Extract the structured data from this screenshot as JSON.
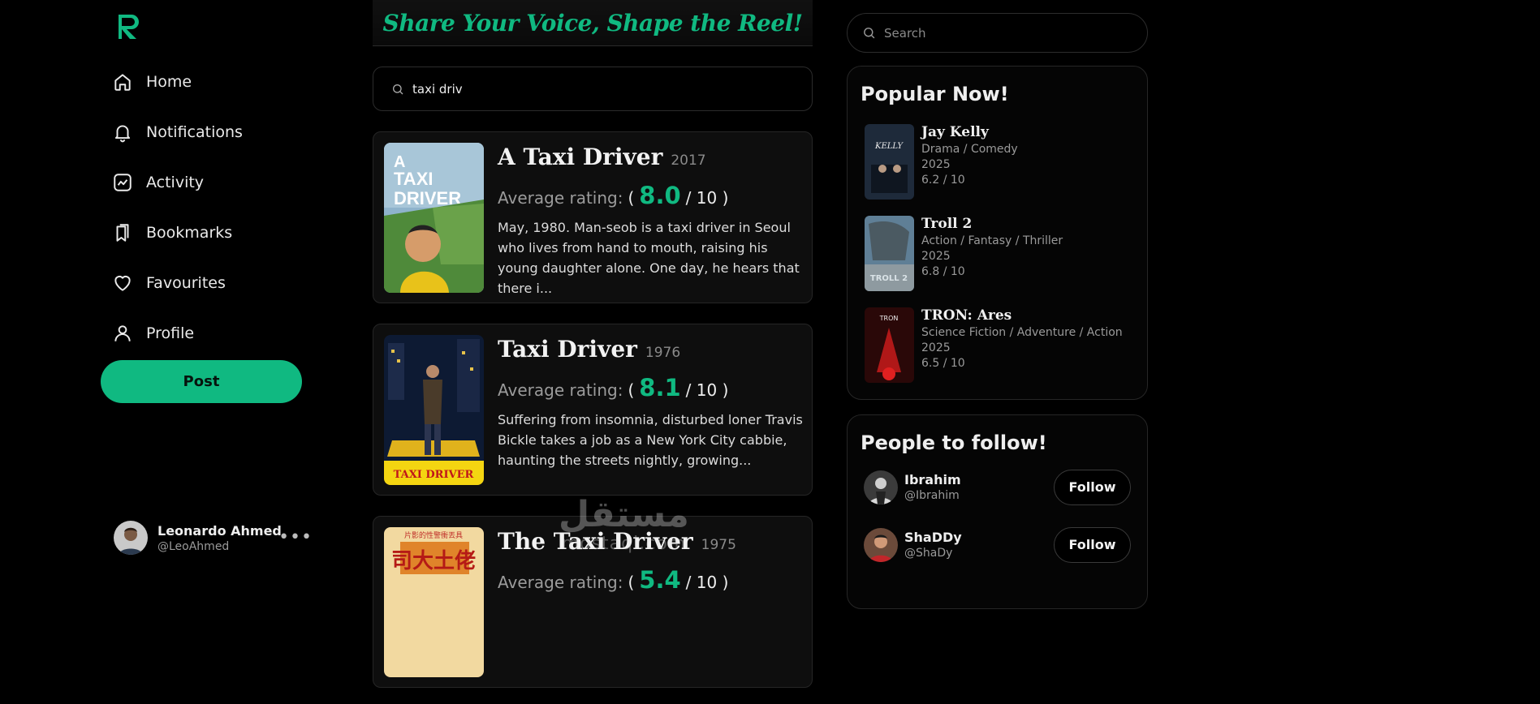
{
  "nav": {
    "items": [
      {
        "label": "Home",
        "icon": "home-icon"
      },
      {
        "label": "Notifications",
        "icon": "bell-icon"
      },
      {
        "label": "Activity",
        "icon": "activity-icon"
      },
      {
        "label": "Bookmarks",
        "icon": "bookmarks-icon"
      },
      {
        "label": "Favourites",
        "icon": "heart-icon"
      },
      {
        "label": "Profile",
        "icon": "user-icon"
      }
    ],
    "post_label": "Post"
  },
  "user": {
    "name": "Leonardo Ahmed",
    "handle": "@LeoAhmed",
    "more": "•••"
  },
  "banner": {
    "text": "Share Your Voice, Shape the Reel!"
  },
  "center_search": {
    "value": "taxi driv"
  },
  "results": [
    {
      "title": "A Taxi Driver",
      "year": "2017",
      "rating_label": "Average rating:",
      "rating": "8.0",
      "rating_max": "/ 10 )",
      "paren_open": "(",
      "description": "May, 1980. Man-seob is a taxi driver in Seoul who lives from hand to mouth, raising his young daughter alone. One day, he hears that there i..."
    },
    {
      "title": "Taxi Driver",
      "year": "1976",
      "rating_label": "Average rating:",
      "rating": "8.1",
      "rating_max": "/ 10 )",
      "paren_open": "(",
      "description": "Suffering from insomnia, disturbed loner Travis Bickle takes a job as a New York City cabbie, haunting the streets nightly, growing..."
    },
    {
      "title": "The Taxi Driver",
      "year": "1975",
      "rating_label": "Average rating:",
      "rating": "5.4",
      "rating_max": "/ 10 )",
      "paren_open": "("
    }
  ],
  "right_search": {
    "placeholder": "Search"
  },
  "popular": {
    "title": "Popular Now!",
    "items": [
      {
        "title": "Jay Kelly",
        "genres": "Drama / Comedy",
        "year": "2025",
        "rating": "6.2 / 10"
      },
      {
        "title": "Troll 2",
        "genres": "Action / Fantasy / Thriller",
        "year": "2025",
        "rating": "6.8 / 10"
      },
      {
        "title": "TRON: Ares",
        "genres": "Science Fiction / Adventure / Action",
        "year": "2025",
        "rating": "6.5 / 10"
      }
    ]
  },
  "follow": {
    "title": "People to follow!",
    "button_label": "Follow",
    "people": [
      {
        "name": "Ibrahim",
        "handle": "@Ibrahim"
      },
      {
        "name": "ShaDDy",
        "handle": "@ShaDy"
      }
    ]
  },
  "watermark": {
    "top": "مستقل",
    "bottom": "mostaql.com"
  },
  "colors": {
    "accent": "#10b981",
    "background": "#000000"
  }
}
